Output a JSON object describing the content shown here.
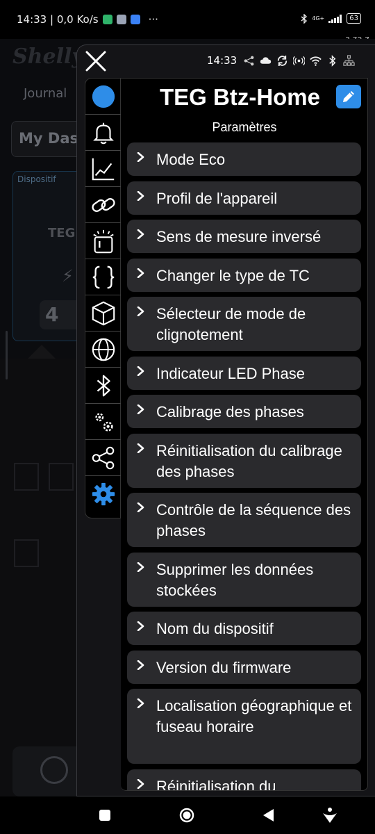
{
  "status_bar": {
    "time_speed": "14:33 | 0,0 Ko/s",
    "more": "···",
    "network": "4G+",
    "battery": "63"
  },
  "app_version": "3.72.7",
  "background_app": {
    "logo": "Shelly",
    "tab": "Journal",
    "dashboard_button": "My Das",
    "card_label": "Dispositif",
    "card_device": "TEG",
    "card_value": "4"
  },
  "panel": {
    "time": "14:33",
    "device_name": "TEG Btz-Home",
    "section_title": "Paramètres"
  },
  "rail_icons": [
    "device-status-icon",
    "notification-bell-icon",
    "chart-icon",
    "link-icon",
    "led-indicator-icon",
    "script-braces-icon",
    "cube-icon",
    "globe-icon",
    "bluetooth-icon",
    "advanced-settings-icon",
    "share-icon",
    "settings-gear-icon"
  ],
  "menu_items": [
    {
      "label": "Mode Eco"
    },
    {
      "label": "Profil de l'appareil"
    },
    {
      "label": "Sens de mesure inversé"
    },
    {
      "label": "Changer le type de TC"
    },
    {
      "label": "Sélecteur de mode de clignotement"
    },
    {
      "label": "Indicateur LED Phase"
    },
    {
      "label": "Calibrage des phases"
    },
    {
      "label": "Réinitialisation du calibrage des phases"
    },
    {
      "label": "Contrôle de la séquence des phases"
    },
    {
      "label": "Supprimer les données stockées"
    },
    {
      "label": "Nom du dispositif"
    },
    {
      "label": "Version du firmware"
    },
    {
      "label": "Localisation géographique et fuseau horaire"
    },
    {
      "label": "Réinitialisation du"
    }
  ],
  "colors": {
    "accent": "#2e8de8",
    "item_bg": "#2a2a2d",
    "panel_bg": "#141417"
  }
}
